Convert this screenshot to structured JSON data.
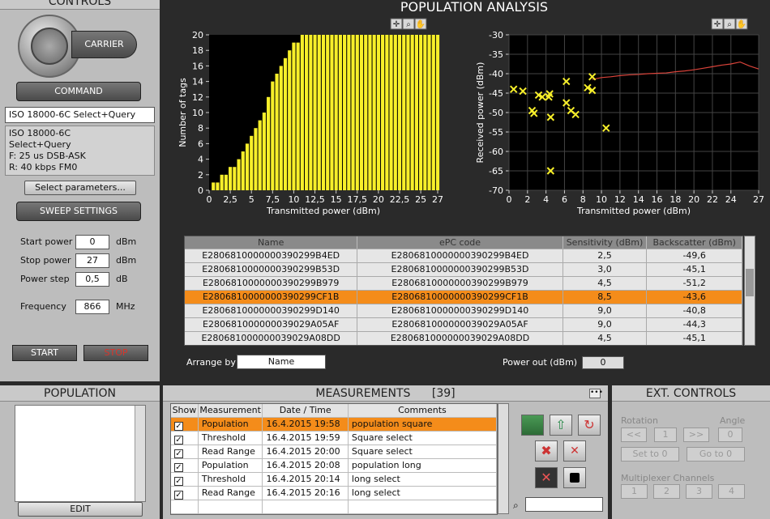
{
  "controls": {
    "title": "CONTROLS",
    "carrier_label": "CARRIER",
    "command_label": "COMMAND",
    "command_select": "ISO 18000-6C Select+Query",
    "command_info": [
      "ISO 18000-6C",
      "Select+Query",
      "F: 25 us DSB-ASK",
      "R: 40 kbps FM0"
    ],
    "select_params_label": "Select parameters...",
    "sweep_label": "SWEEP SETTINGS",
    "start_power_label": "Start power",
    "start_power_value": "0",
    "start_power_unit": "dBm",
    "stop_power_label": "Stop power",
    "stop_power_value": "27",
    "stop_power_unit": "dBm",
    "power_step_label": "Power step",
    "power_step_value": "0,5",
    "power_step_unit": "dB",
    "frequency_label": "Frequency",
    "frequency_value": "866",
    "frequency_unit": "MHz",
    "start_label": "START",
    "stop_label": "STOP"
  },
  "analysis": {
    "title": "POPULATION ANALYSIS",
    "arrange_label": "Arrange by",
    "arrange_value": "Name",
    "power_out_label": "Power out (dBm)",
    "power_out_value": "0",
    "table": {
      "headers": [
        "Name",
        "ePC code",
        "Sensitivity (dBm)",
        "Backscatter (dBm)"
      ],
      "rows": [
        [
          "E2806810000000390299B4ED",
          "E2806810000000390299B4ED",
          "2,5",
          "-49,6"
        ],
        [
          "E2806810000000390299B53D",
          "E2806810000000390299B53D",
          "3,0",
          "-45,1"
        ],
        [
          "E2806810000000390299B979",
          "E2806810000000390299B979",
          "4,5",
          "-51,2"
        ],
        [
          "E2806810000000390299CF1B",
          "E2806810000000390299CF1B",
          "8,5",
          "-43,6"
        ],
        [
          "E2806810000000390299D140",
          "E2806810000000390299D140",
          "9,0",
          "-40,8"
        ],
        [
          "E280681000000039029A05AF",
          "E280681000000039029A05AF",
          "9,0",
          "-44,3"
        ],
        [
          "E280681000000039029A08DD",
          "E280681000000039029A08DD",
          "4,5",
          "-45,1"
        ]
      ]
    }
  },
  "population": {
    "title": "POPULATION",
    "edit_label": "EDIT"
  },
  "measurements": {
    "title": "MEASUREMENTS",
    "count": "[39]",
    "headers": [
      "Show",
      "Measurement",
      "Date / Time",
      "Comments"
    ],
    "rows": [
      [
        "Population",
        "16.4.2015 19:58",
        "population square"
      ],
      [
        "Threshold",
        "16.4.2015 19:59",
        "Square select"
      ],
      [
        "Read Range",
        "16.4.2015 20:00",
        "Square select"
      ],
      [
        "Population",
        "16.4.2015 20:08",
        "population long"
      ],
      [
        "Threshold",
        "16.4.2015 20:14",
        "long select"
      ],
      [
        "Read Range",
        "16.4.2015 20:16",
        "long select"
      ]
    ]
  },
  "ext": {
    "title": "EXT. CONTROLS",
    "rotation_label": "Rotation",
    "angle_label": "Angle",
    "rot_back": "<<",
    "rot_value": "1",
    "rot_fwd": ">>",
    "angle_value": "0",
    "set_to_0": "Set to 0",
    "go_to_0": "Go to 0",
    "mux_label": "Multiplexer Channels",
    "channels": [
      "1",
      "2",
      "3",
      "4"
    ]
  },
  "chart_data": [
    {
      "type": "bar",
      "xlabel": "Transmitted power (dBm)",
      "ylabel": "Number of tags",
      "xlim": [
        0,
        27
      ],
      "ylim": [
        0,
        20
      ],
      "xticks": [
        "0",
        "2,5",
        "5",
        "7,5",
        "10",
        "12,5",
        "15",
        "17,5",
        "20",
        "22,5",
        "25",
        "27"
      ],
      "yticks": [
        "0",
        "2",
        "4",
        "6",
        "8",
        "10",
        "12",
        "14",
        "16",
        "18",
        "20"
      ],
      "x": [
        0.5,
        1,
        1.5,
        2,
        2.5,
        3,
        3.5,
        4,
        4.5,
        5,
        5.5,
        6,
        6.5,
        7,
        7.5,
        8,
        8.5,
        9,
        9.5,
        10,
        10.5,
        11
      ],
      "values": [
        1,
        1,
        2,
        2,
        3,
        3,
        4,
        5,
        6,
        7,
        8,
        9,
        10,
        12,
        14,
        15,
        16,
        17,
        18,
        19,
        19,
        20
      ],
      "fill_value_after": 20,
      "color": "#f7ef2a"
    },
    {
      "type": "scatter",
      "xlabel": "Transmitted power (dBm)",
      "ylabel": "Received power (dBm)",
      "xlim": [
        0,
        27
      ],
      "ylim": [
        -70,
        -30
      ],
      "xticks": [
        "0",
        "2",
        "4",
        "6",
        "8",
        "10",
        "12",
        "14",
        "16",
        "18",
        "20",
        "22",
        "24",
        "27"
      ],
      "yticks": [
        "-30",
        "-35",
        "-40",
        "-45",
        "-50",
        "-55",
        "-60",
        "-65",
        "-70"
      ],
      "points": [
        [
          0.5,
          -44
        ],
        [
          1.5,
          -44.5
        ],
        [
          2.5,
          -49.5
        ],
        [
          2.7,
          -50.2
        ],
        [
          3.2,
          -45.5
        ],
        [
          3.6,
          -46
        ],
        [
          4.3,
          -46
        ],
        [
          4.4,
          -45.2
        ],
        [
          4.5,
          -51.2
        ],
        [
          4.5,
          -65
        ],
        [
          6.2,
          -42
        ],
        [
          6.2,
          -47.5
        ],
        [
          6.7,
          -49.5
        ],
        [
          7.2,
          -50.5
        ],
        [
          8.5,
          -43.6
        ],
        [
          9.0,
          -40.8
        ],
        [
          9.0,
          -44.3
        ],
        [
          10.5,
          -54
        ]
      ],
      "series": [
        {
          "name": "",
          "x": [
            9,
            10,
            11,
            12,
            13,
            14,
            15,
            16,
            17,
            18,
            19,
            20,
            21,
            22,
            23,
            24,
            25,
            26,
            27
          ],
          "values": [
            -41.5,
            -41,
            -40.8,
            -40.5,
            -40.3,
            -40.2,
            -40,
            -39.9,
            -39.8,
            -39.5,
            -39.3,
            -39,
            -38.6,
            -38.2,
            -37.8,
            -37.5,
            -37,
            -38,
            -38.8
          ]
        }
      ],
      "marker_color": "#f7ef2a",
      "line_color": "#d9433a"
    }
  ]
}
